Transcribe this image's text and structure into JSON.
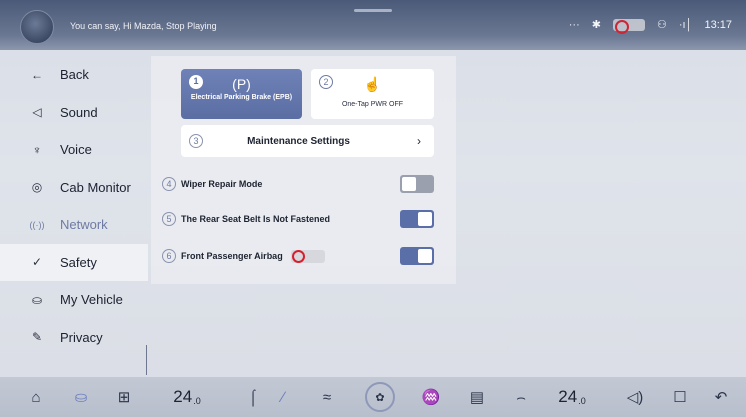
{
  "status_bar": {
    "voice_hint": "You can say, Hi Mazda, Stop Playing",
    "more_label": "···",
    "signal_label": "·ı│",
    "clock": "13:17"
  },
  "menu": {
    "items": [
      {
        "label": "Back",
        "icon": "back-arrow-icon",
        "glyph": "←"
      },
      {
        "label": "Sound",
        "icon": "speaker-icon",
        "glyph": "◁"
      },
      {
        "label": "Voice",
        "icon": "microphone-icon",
        "glyph": "♆"
      },
      {
        "label": "Cab Monitor",
        "icon": "camera-icon",
        "glyph": "◎"
      },
      {
        "label": "Network",
        "icon": "wifi-icon",
        "glyph": "((·))"
      },
      {
        "label": "Safety",
        "icon": "shield-icon",
        "glyph": "✓"
      },
      {
        "label": "My Vehicle",
        "icon": "car-icon",
        "glyph": "⛀"
      },
      {
        "label": "Privacy",
        "icon": "edit-icon",
        "glyph": "✎"
      }
    ]
  },
  "buttons": {
    "epb": {
      "number": "1",
      "icon_glyph": "(P)",
      "label": "Electrical Parking Brake (EPB)"
    },
    "pwr": {
      "number": "2",
      "icon_glyph": "☝",
      "label": "One-Tap PWR OFF"
    }
  },
  "maintenance": {
    "number": "3",
    "label": "Maintenance Settings",
    "chevron": "›"
  },
  "toggles": [
    {
      "number": "4",
      "label": "Wiper Repair Mode",
      "state": "off"
    },
    {
      "number": "5",
      "label": "The Rear Seat Belt Is Not Fastened",
      "state": "on"
    },
    {
      "number": "6",
      "label": "Front Passenger Airbag",
      "state": "on"
    }
  ],
  "dock": {
    "home_glyph": "⌂",
    "car_glyph": "⛀",
    "apps_glyph": "⊞",
    "temp_left": "24",
    "temp_left_unit": ".0",
    "seat_heat_glyph": "⌠",
    "wiper_glyph": "∕",
    "air_recirc_glyph": "≈",
    "fan_glyph": "✿",
    "defrost_front_glyph": "♒",
    "defrost_rear_glyph": "▤",
    "seat_glyph": "⌢",
    "temp_right": "24",
    "temp_right_unit": ".0",
    "volume_glyph": "◁)",
    "lock_glyph": "☐",
    "trunk_glyph": "↶"
  }
}
